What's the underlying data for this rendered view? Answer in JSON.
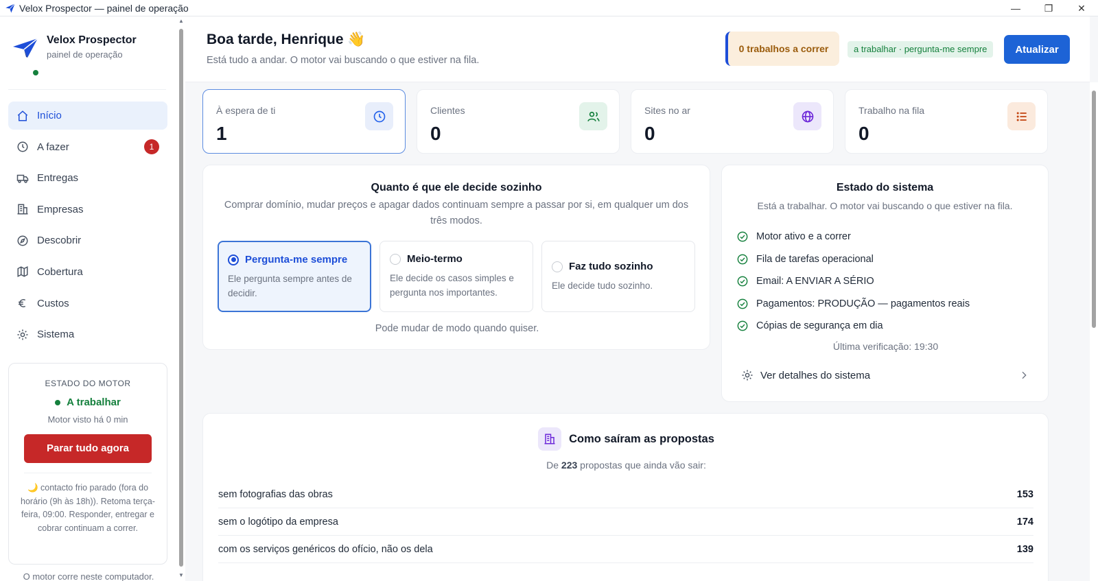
{
  "window": {
    "title": "Velox Prospector — painel de operação",
    "controls": {
      "minimize": "—",
      "maximize": "❐",
      "close": "✕"
    }
  },
  "sidebar": {
    "brand_name": "Velox Prospector",
    "brand_sub": "painel de operação",
    "nav": [
      {
        "label": "Início",
        "icon": "home-icon"
      },
      {
        "label": "A fazer",
        "icon": "clock-icon",
        "badge": "1"
      },
      {
        "label": "Entregas",
        "icon": "truck-icon"
      },
      {
        "label": "Empresas",
        "icon": "building-icon"
      },
      {
        "label": "Descobrir",
        "icon": "compass-icon"
      },
      {
        "label": "Cobertura",
        "icon": "map-icon"
      },
      {
        "label": "Custos",
        "icon": "euro-icon"
      },
      {
        "label": "Sistema",
        "icon": "sun-gear-icon"
      }
    ],
    "engine": {
      "title": "ESTADO DO MOTOR",
      "status": "A trabalhar",
      "seen": "Motor visto há 0 min",
      "stop_label": "Parar tudo agora",
      "note": "🌙 contacto frio parado (fora do horário (9h às 18h)). Retoma terça-feira, 09:00. Responder, entregar e cobrar continuam a correr."
    },
    "footer": "O motor corre neste computador."
  },
  "header": {
    "greeting": "Boa tarde, Henrique 👋",
    "subtitle": "Está tudo a andar. O motor vai buscando o que estiver na fila.",
    "jobs_pill": "0 trabalhos a correr",
    "mode_pill": "a trabalhar · pergunta-me sempre",
    "refresh_label": "Atualizar"
  },
  "stats": [
    {
      "label": "À espera de ti",
      "value": "1",
      "icon": "clock-icon",
      "color": "#2563eb",
      "bg": "#e8eefb"
    },
    {
      "label": "Clientes",
      "value": "0",
      "icon": "users-icon",
      "color": "#15803d",
      "bg": "#e3f3ea"
    },
    {
      "label": "Sites no ar",
      "value": "0",
      "icon": "globe-icon",
      "color": "#6d28d9",
      "bg": "#ece7fb"
    },
    {
      "label": "Trabalho na fila",
      "value": "0",
      "icon": "list-icon",
      "color": "#c2410c",
      "bg": "#fbeadd"
    }
  ],
  "autonomy": {
    "title": "Quanto é que ele decide sozinho",
    "description": "Comprar domínio, mudar preços e apagar dados continuam sempre a passar por si, em qualquer um dos três modos.",
    "options": [
      {
        "label": "Pergunta-me sempre",
        "desc": "Ele pergunta sempre antes de decidir.",
        "selected": true
      },
      {
        "label": "Meio-termo",
        "desc": "Ele decide os casos simples e pergunta nos importantes.",
        "selected": false
      },
      {
        "label": "Faz tudo sozinho",
        "desc": "Ele decide tudo sozinho.",
        "selected": false
      }
    ],
    "footer": "Pode mudar de modo quando quiser."
  },
  "system": {
    "title": "Estado do sistema",
    "description": "Está a trabalhar. O motor vai buscando o que estiver na fila.",
    "checks": [
      "Motor ativo e a correr",
      "Fila de tarefas operacional",
      "Email: A ENVIAR A SÉRIO",
      "Pagamentos: PRODUÇÃO — pagamentos reais",
      "Cópias de segurança em dia"
    ],
    "last_check": "Última verificação: 19:30",
    "details_label": "Ver detalhes do sistema"
  },
  "proposals": {
    "title": "Como saíram as propostas",
    "sub_prefix": "De",
    "total": "223",
    "sub_suffix": "propostas que ainda vão sair:",
    "rows": [
      {
        "label": "sem fotografias das obras",
        "value": "153"
      },
      {
        "label": "sem o logótipo da empresa",
        "value": "174"
      },
      {
        "label": "com os serviços genéricos do ofício, não os dela",
        "value": "139"
      }
    ]
  },
  "colors": {
    "accent": "#1d63d6",
    "danger": "#c62828",
    "success": "#15803d"
  }
}
